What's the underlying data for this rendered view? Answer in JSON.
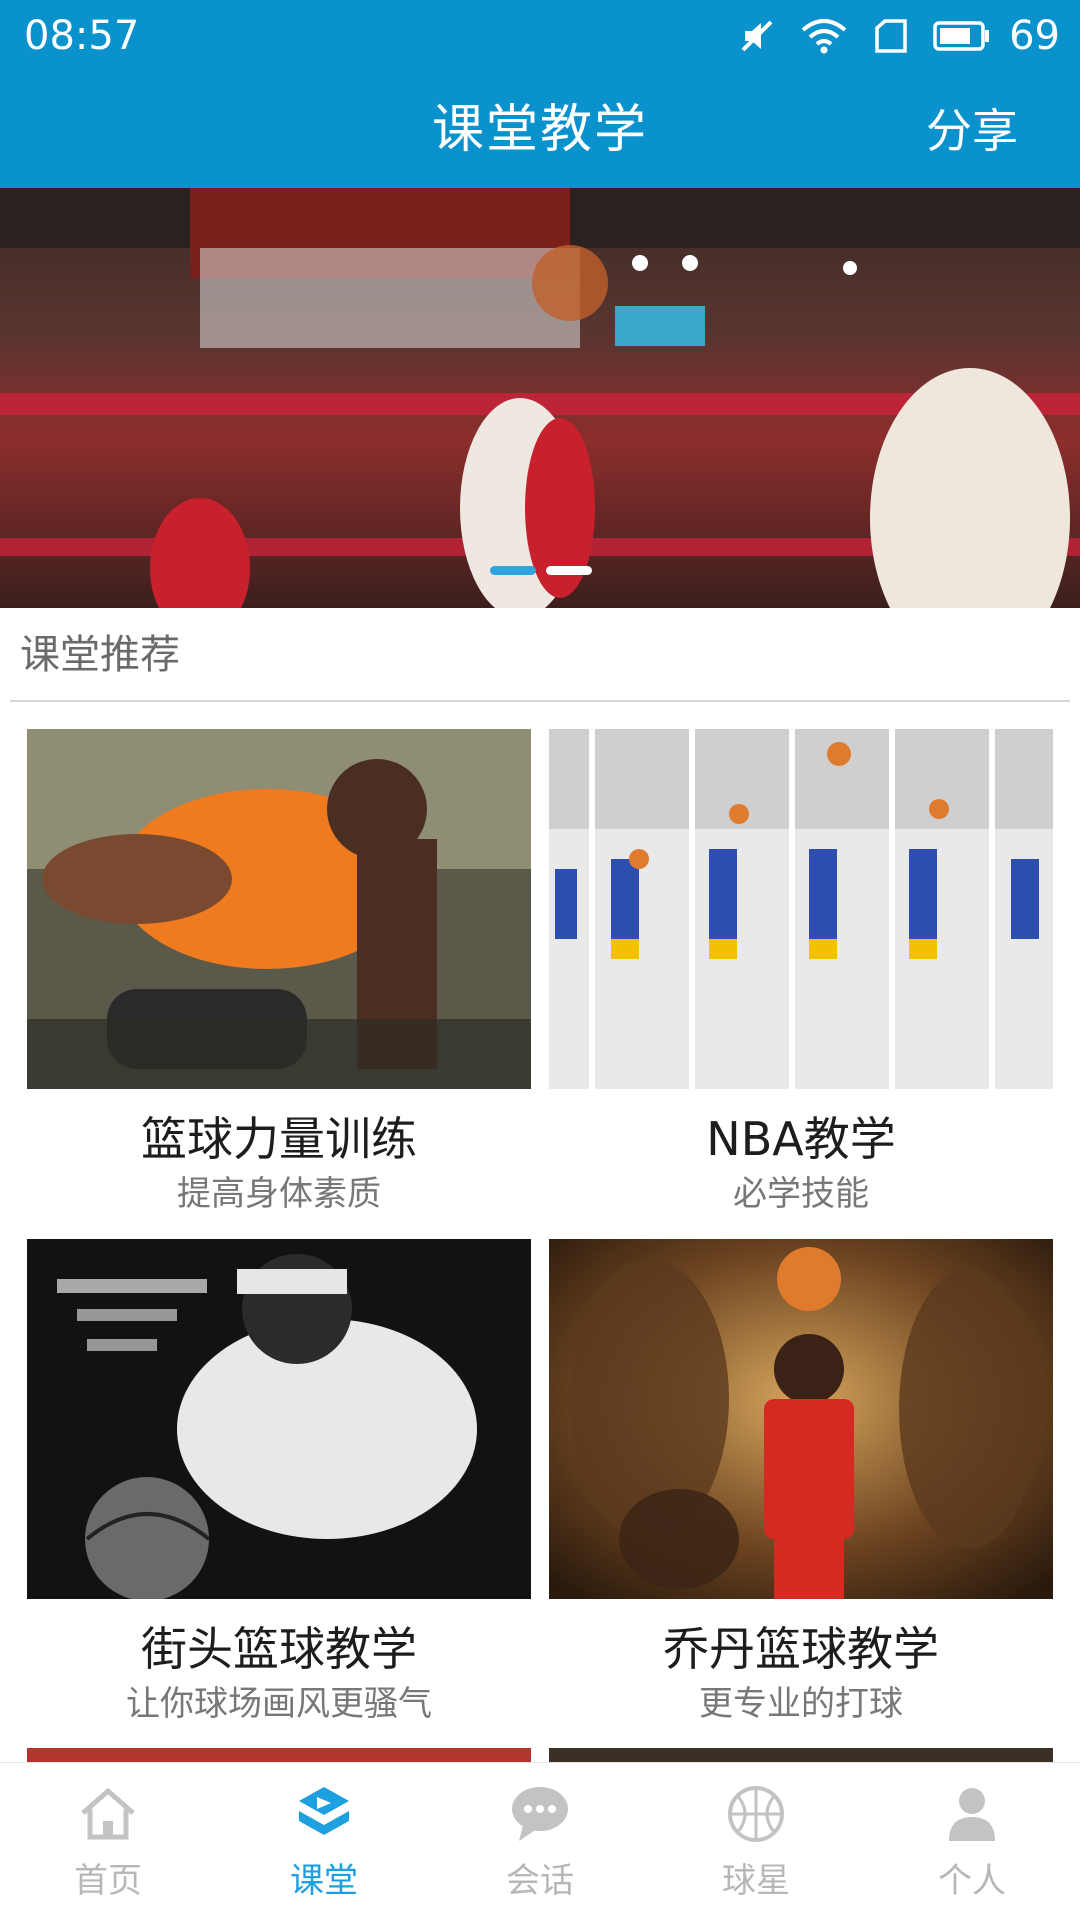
{
  "status_bar": {
    "time": "08:57",
    "battery": "69"
  },
  "header": {
    "title": "课堂教学",
    "share_label": "分享"
  },
  "banner": {
    "slides": 2,
    "active_index": 0
  },
  "section": {
    "title": "课堂推荐"
  },
  "cards": [
    {
      "title": "篮球力量训练",
      "subtitle": "提高身体素质"
    },
    {
      "title": "NBA教学",
      "subtitle": "必学技能"
    },
    {
      "title": "街头篮球教学",
      "subtitle": "让你球场画风更骚气"
    },
    {
      "title": "乔丹篮球教学",
      "subtitle": "更专业的打球"
    }
  ],
  "bottom_nav": [
    {
      "label": "首页",
      "icon": "home-icon"
    },
    {
      "label": "课堂",
      "icon": "classroom-icon",
      "active": true
    },
    {
      "label": "会话",
      "icon": "chat-icon"
    },
    {
      "label": "球星",
      "icon": "basketball-icon"
    },
    {
      "label": "个人",
      "icon": "person-icon"
    }
  ],
  "colors": {
    "primary": "#0a92cc",
    "active_tab": "#1e9fe0",
    "inactive_tab": "#b7b7b7"
  }
}
